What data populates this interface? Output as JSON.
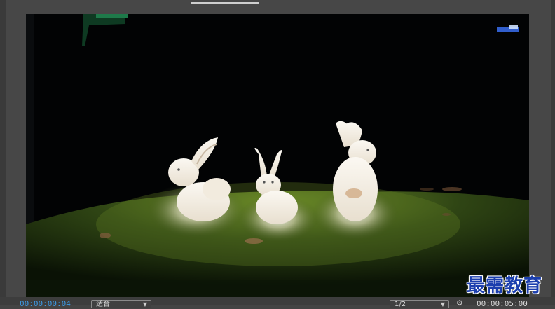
{
  "player": {
    "current_time": "00:00:00:04",
    "duration": "00:00:05:00",
    "zoom_label": "适合",
    "resolution_label": "1/2"
  },
  "icons": {
    "zoom_chevron": "chevron-down-icon",
    "resolution_chevron": "chevron-down-icon",
    "settings": "wrench-icon"
  },
  "watermark": {
    "text": "最需教育"
  },
  "colors": {
    "accent_timecode": "#3e9be6",
    "panel_bg": "#474747",
    "watermark": "#1c3fae"
  }
}
